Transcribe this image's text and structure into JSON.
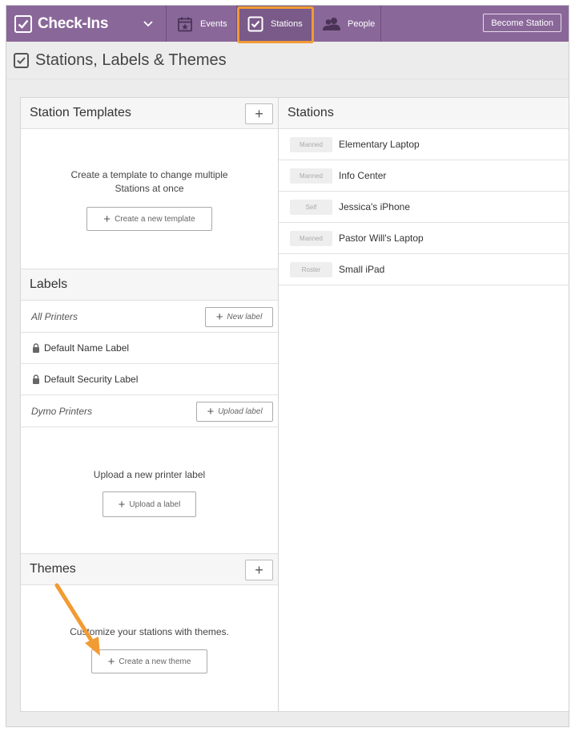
{
  "nav": {
    "app_title": "Check-Ins",
    "tabs": [
      {
        "label": "Events",
        "icon": "calendar-star-icon"
      },
      {
        "label": "Stations",
        "icon": "checkbox-icon"
      },
      {
        "label": "People",
        "icon": "people-icon"
      }
    ],
    "active_tab": "Stations",
    "become_station_label": "Become Station"
  },
  "page": {
    "title": "Stations, Labels & Themes"
  },
  "station_templates": {
    "heading": "Station Templates",
    "add_symbol": "+",
    "empty_text_1": "Create a template to change multiple",
    "empty_text_2": "Stations at once",
    "create_button": "Create a new template"
  },
  "labels": {
    "heading": "Labels",
    "groups": [
      {
        "name": "All Printers",
        "button": "New label"
      },
      {
        "name": "Dymo Printers",
        "button": "Upload label"
      }
    ],
    "items": [
      "Default Name Label",
      "Default Security Label"
    ],
    "upload_text": "Upload a new printer label",
    "upload_button": "Upload a label"
  },
  "themes": {
    "heading": "Themes",
    "add_symbol": "+",
    "empty_text": "Customize your stations with themes.",
    "create_button": "Create a new theme"
  },
  "stations": {
    "heading": "Stations",
    "rows": [
      {
        "mode": "Manned",
        "name": "Elementary Laptop"
      },
      {
        "mode": "Manned",
        "name": "Info Center"
      },
      {
        "mode": "Self",
        "name": "Jessica's iPhone"
      },
      {
        "mode": "Manned",
        "name": "Pastor Will's Laptop"
      },
      {
        "mode": "Roster",
        "name": "Small iPad"
      }
    ]
  },
  "colors": {
    "nav_purple": "#8a6799",
    "highlight_orange": "#f19b32"
  }
}
